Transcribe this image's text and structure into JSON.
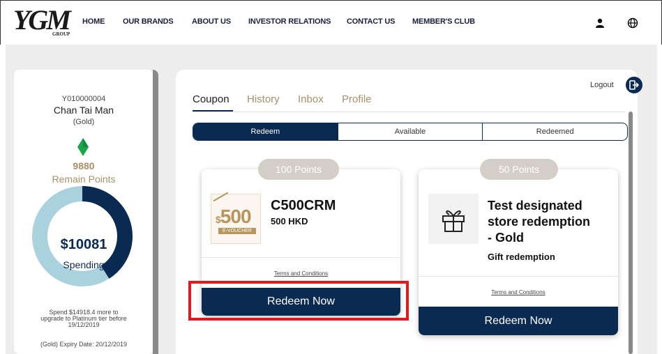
{
  "header": {
    "logo": "YGM",
    "logo_sub": "GROUP",
    "nav": [
      "HOME",
      "OUR BRANDS",
      "ABOUT US",
      "INVESTOR RELATIONS",
      "CONTACT US",
      "MEMBER'S CLUB"
    ],
    "icons": [
      "user-icon",
      "globe-icon"
    ]
  },
  "member": {
    "id": "Y010000004",
    "name": "Chan Tai Man",
    "tier": "(Gold)",
    "points": "9880",
    "points_label": "Remain Points",
    "spending": "$10081",
    "spending_label": "Spending",
    "spending_progress": 0.41,
    "upgrade_text": [
      "Spend $14918.4 more to",
      "upgrade to Platinum tier before",
      "19/12/2019"
    ],
    "expiry": "(Gold) Expiry Date: 20/12/2019",
    "colors": {
      "gem": "#1aa64a",
      "ring_fill": "#0b2a52",
      "ring_track": "#a9d1de",
      "accent": "#a98e6a"
    }
  },
  "logout": "Logout",
  "tabs": [
    "Coupon",
    "History",
    "Inbox",
    "Profile"
  ],
  "segments": [
    "Redeem",
    "Available",
    "Redeemed"
  ],
  "coupons": [
    {
      "points": "100 Points",
      "title": "C500CRM",
      "subtitle": "500 HKD",
      "voucher_amount": "500",
      "voucher_currency": "$",
      "voucher_label": "E-VOUCHER",
      "terms": "Terms and Conditions",
      "button": "Redeem Now"
    },
    {
      "points": "50 Points",
      "title_lines": [
        "Test designated",
        "store redemption",
        "- Gold"
      ],
      "subtitle": "Gift redemption",
      "terms": "Terms and Conditions",
      "button": "Redeem Now",
      "icon": "gift-icon"
    }
  ]
}
